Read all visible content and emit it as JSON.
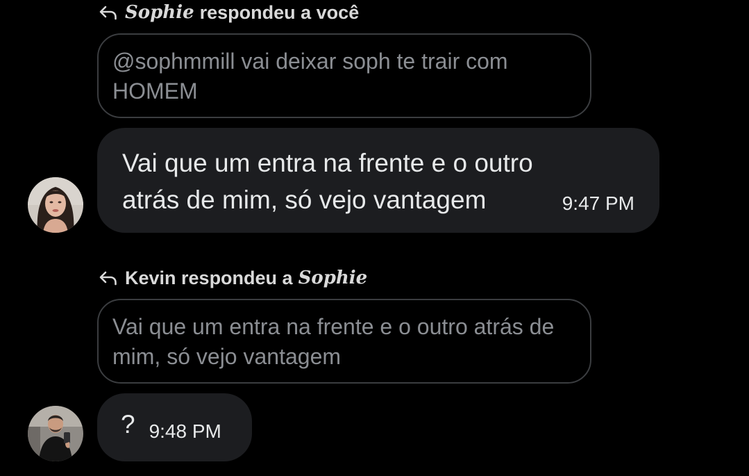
{
  "messages": [
    {
      "reply_header": {
        "name": "Sophie",
        "text": "respondeu a você"
      },
      "quoted_text": "@sophmmill vai deixar soph te trair com HOMEM",
      "body": "Vai que um entra na frente e o outro atrás de mim, só vejo vantagem",
      "time": "9:47 PM",
      "avatar": "sophie-avatar"
    },
    {
      "reply_header": {
        "text": "Kevin respondeu a",
        "name": "Sophie"
      },
      "quoted_text": "Vai que um entra na frente e o outro atrás de mim, só vejo vantagem",
      "body": "?",
      "time": "9:48 PM",
      "avatar": "kevin-avatar"
    }
  ],
  "icons": {
    "reply": "reply-arrow-icon"
  },
  "colors": {
    "background": "#000000",
    "bubble": "#1c1d20",
    "quote_border": "#3b3d40",
    "quote_text": "#8b8e93",
    "text": "#e7e9ea"
  }
}
